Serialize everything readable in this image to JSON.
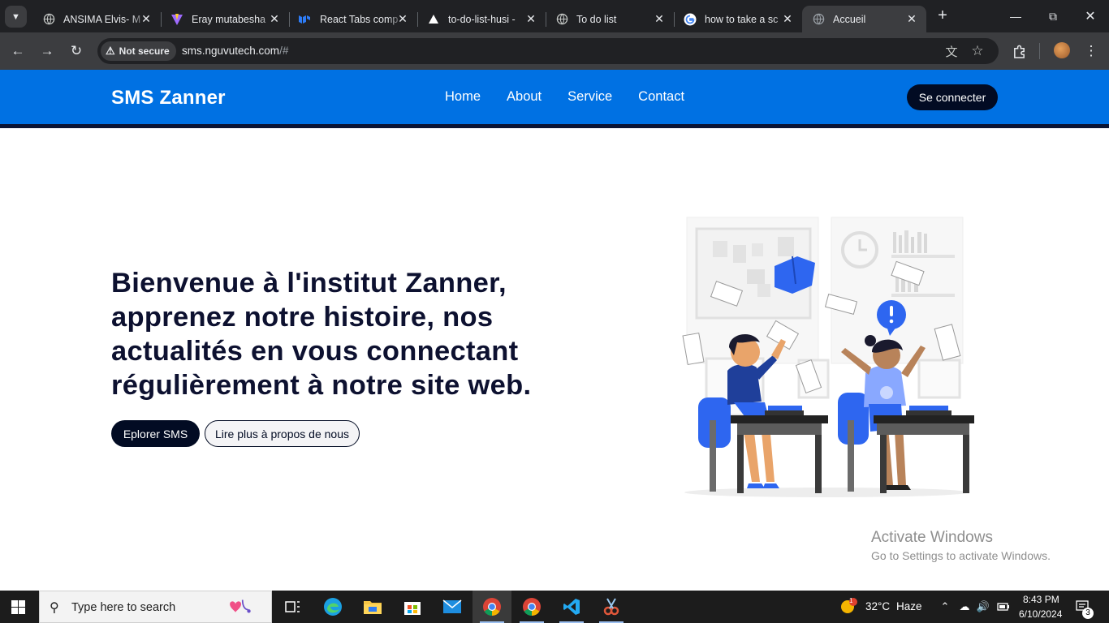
{
  "browser": {
    "tabs": [
      {
        "title": "ANSIMA Elvis- M",
        "favicon": "globe-icon"
      },
      {
        "title": "Eray mutabesha",
        "favicon": "vite-icon"
      },
      {
        "title": "React Tabs comp",
        "favicon": "mui-icon"
      },
      {
        "title": "to-do-list-husi -",
        "favicon": "vercel-icon"
      },
      {
        "title": "To do list",
        "favicon": "globe-icon"
      },
      {
        "title": "how to take a sc",
        "favicon": "google-icon"
      },
      {
        "title": "Accueil",
        "favicon": "globe-icon",
        "active": true
      }
    ],
    "security_label": "Not secure",
    "url_host": "sms.nguvutech.com",
    "url_path": "/#"
  },
  "site": {
    "logo": "SMS Zanner",
    "nav": [
      "Home",
      "About",
      "Service",
      "Contact"
    ],
    "login_label": "Se connecter",
    "accent_color": "#0071e3",
    "dark_color": "#020b23"
  },
  "hero": {
    "title": "Bienvenue à l'institut Zanner, apprenez notre histoire, nos actualités en vous connectant régulièrement à notre site web.",
    "primary_button": "Eplorer SMS",
    "secondary_button": "Lire plus à propos de nous"
  },
  "watermark": {
    "line1": "Activate Windows",
    "line2": "Go to Settings to activate Windows."
  },
  "taskbar": {
    "search_placeholder": "Type here to search",
    "weather_temp": "32°C",
    "weather_desc": "Haze",
    "weather_badge": "1",
    "time": "8:43 PM",
    "date": "6/10/2024",
    "notification_count": "3"
  }
}
